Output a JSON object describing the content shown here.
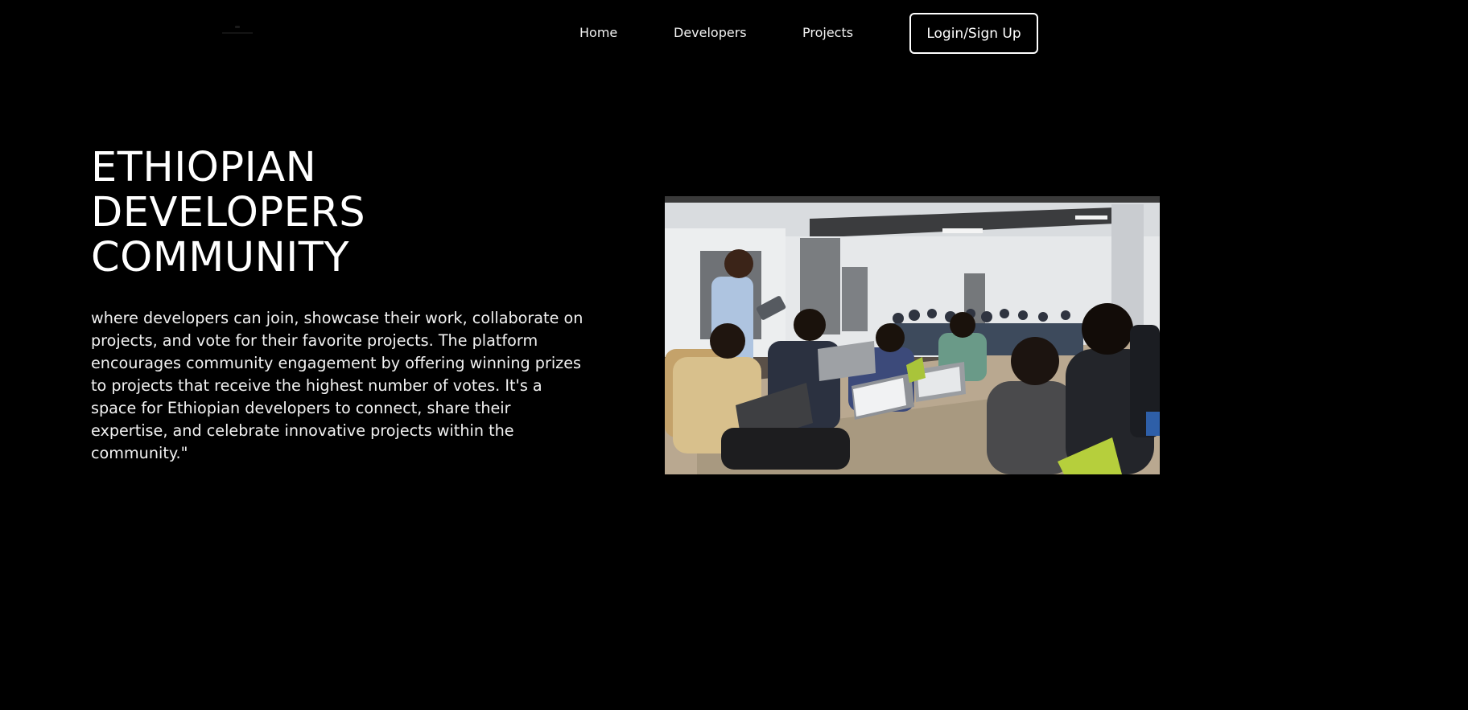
{
  "nav": {
    "logo_icon": "brand-logo-icon",
    "links": [
      {
        "label": "Home"
      },
      {
        "label": "Developers"
      },
      {
        "label": "Projects"
      }
    ],
    "login_label": "Login/Sign Up"
  },
  "hero": {
    "title_lines": [
      "ETHIOPIAN",
      "DEVELOPERS",
      "COMMUNITY"
    ],
    "description": "where developers can join, showcase their work, collaborate on projects, and vote for their favorite projects. The platform encourages community engagement by offering winning prizes to projects that receive the highest number of votes. It's a space for Ethiopian developers to connect, share their expertise, and celebrate innovative projects within the community.\"",
    "image_icon": "classroom-photo"
  },
  "colors": {
    "background": "#000000",
    "text": "#ffffff",
    "button_border": "#ffffff"
  }
}
